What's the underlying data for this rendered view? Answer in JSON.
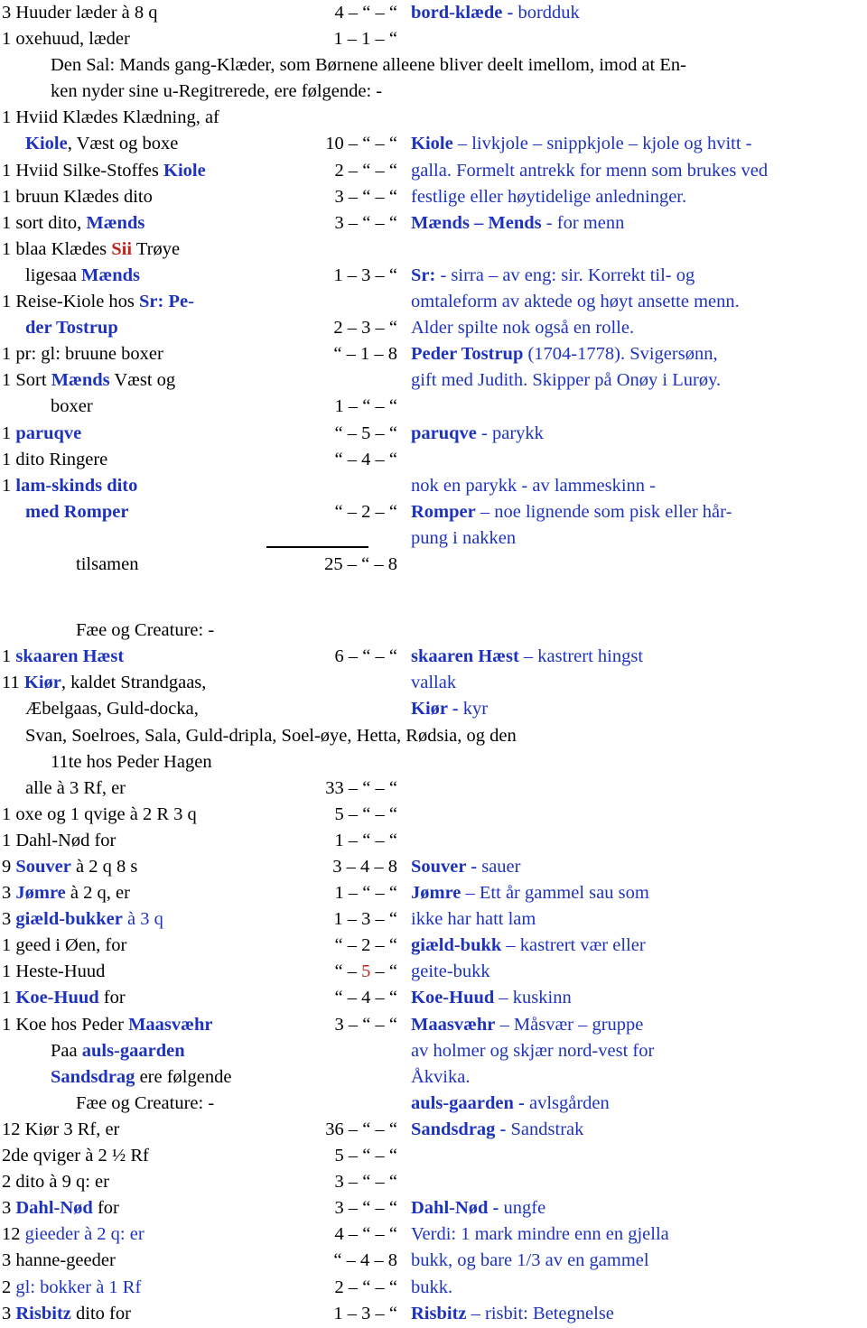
{
  "document": {
    "type": "historical-probate-inventory-transcription",
    "colors": {
      "body_text": "#000000",
      "annotation_blue": "#1d33bd",
      "highlight_red": "#c0261a",
      "background": "#ffffff"
    }
  },
  "rows": [
    {
      "item_plain": "3 Huuder læder à 8 q",
      "amount": "4 – “ – “",
      "note": "bord-klæde - bordduk",
      "note_bold_prefix": "bord-klæde -",
      "note_rest": " bordduk"
    },
    {
      "item_plain": "1 oxehuud, læder",
      "amount": "1 – 1 – “",
      "note": ""
    },
    {
      "item_plain": "Den Sal: Mands gang-Klæder, som Børnene alleene bliver deelt imellom, imod at En-",
      "amount": "",
      "note": ""
    },
    {
      "item_plain": "ken nyder sine u-Regitrerede, ere følgende: -",
      "amount": "",
      "note": ""
    },
    {
      "item_plain": "1 Hviid Klædes Klædning, af",
      "amount": "",
      "note": ""
    },
    {
      "item_plain": "Kiole, Væst og boxe",
      "amount": "10 – “ – “",
      "note": "Kiole – livkjole – snippkjole – kjole og hvitt -"
    },
    {
      "item_plain": "1 Hviid Silke-Stoffes Kiole",
      "amount": "2 – “ – “",
      "note": "galla. Formelt antrekk for menn som brukes ved"
    },
    {
      "item_plain": "1 bruun Klædes dito",
      "amount": "3 – “ – “",
      "note": "festlige eller høytidelige anledninger."
    },
    {
      "item_plain": "1 sort dito, Mænds",
      "amount": "3 – “ – “",
      "note": "Mænds – Mends  - for menn"
    },
    {
      "item_plain": "1 blaa Klædes Sii Trøye",
      "amount": "",
      "note": ""
    },
    {
      "item_plain": "ligesaa Mænds",
      "amount": "1 – 3 – “",
      "note": "Sr: - sirra – av eng: sir. Korrekt til- og"
    },
    {
      "item_plain": "1 Reise-Kiole hos Sr: Pe-",
      "amount": "",
      "note": "omtaleform av aktede og høyt ansette menn."
    },
    {
      "item_plain": "der Tostrup",
      "amount": "2 – 3 – “",
      "note": "Alder spilte nok også en rolle."
    },
    {
      "item_plain": "1 pr: gl: bruune boxer",
      "amount": "“ – 1 – 8",
      "note": "Peder Tostrup (1704-1778). Svigersønn,"
    },
    {
      "item_plain": "1 Sort Mænds Væst og",
      "amount": "",
      "note": "gift med Judith. Skipper på Onøy i Lurøy."
    },
    {
      "item_plain": "boxer",
      "amount": "1 – “ – “",
      "note": ""
    },
    {
      "item_plain": "1 paruqve",
      "amount": "“ – 5 – “",
      "note": "paruqve - parykk"
    },
    {
      "item_plain": "1 dito Ringere",
      "amount": "“ – 4 – “",
      "note": ""
    },
    {
      "item_plain": "1 lam-skinds dito",
      "amount": "",
      "note": "nok en parykk - av lammeskinn -"
    },
    {
      "item_plain": "med Romper",
      "amount": "“ – 2 – “",
      "note": "Romper – noe lignende som pisk eller hår-"
    },
    {
      "item_plain": "",
      "amount": "",
      "note": "pung i nakken"
    },
    {
      "item_plain": "tilsamen",
      "amount": "25 – “ – 8",
      "note": ""
    },
    {
      "item_plain": "Fæe og Creature: -",
      "amount": "",
      "note": ""
    },
    {
      "item_plain": "1 skaaren Hæst",
      "amount": "6 – “ – “",
      "note": "skaaren Hæst – kastrert hingst"
    },
    {
      "item_plain": "11 Kiør, kaldet Strandgaas,",
      "amount": "",
      "note": "vallak"
    },
    {
      "item_plain": "Æbelgaas, Guld-docka,",
      "amount": "",
      "note": "Kiør - kyr"
    },
    {
      "item_plain": "Svan, Soelroes, Sala, Guld-dripla, Soel-øye, Hetta, Rødsia, og den",
      "amount": "",
      "note": ""
    },
    {
      "item_plain": "11te hos Peder Hagen",
      "amount": "",
      "note": ""
    },
    {
      "item_plain": "alle à 3 Rf, er",
      "amount": "33 – “ – “",
      "note": ""
    },
    {
      "item_plain": "1 oxe og 1 qvige à 2 R 3 q",
      "amount": "5 – “ – “",
      "note": ""
    },
    {
      "item_plain": "1 Dahl-Nød for",
      "amount": "1 – “ – “",
      "note": ""
    },
    {
      "item_plain": "9 Souver à 2 q 8 s",
      "amount": "3 – 4 – 8",
      "note": "Souver - sauer"
    },
    {
      "item_plain": "3 Jømre à 2 q, er",
      "amount": "1 – “ – “",
      "note": "Jømre – Ett år gammel sau som"
    },
    {
      "item_plain": "3 giæld-bukker à 3 q",
      "amount": "1 – 3 – “",
      "note": "ikke har hatt lam"
    },
    {
      "item_plain": "1 geed i Øen, for",
      "amount": "“ – 2 – “",
      "note": "giæld-bukk – kastrert vær eller"
    },
    {
      "item_plain": "1 Heste-Huud",
      "amount": "“ – 5 – “",
      "note": "geite-bukk"
    },
    {
      "item_plain": "1 Koe-Huud for",
      "amount": "“ – 4 – “",
      "note": "Koe-Huud – kuskinn"
    },
    {
      "item_plain": "1 Koe hos Peder Maasvæhr",
      "amount": "3 – “ – “",
      "note": "Maasvæhr – Måsvær – gruppe"
    },
    {
      "item_plain": "Paa auls-gaarden",
      "amount": "",
      "note": "av holmer og skjær nord-vest for"
    },
    {
      "item_plain": "Sandsdrag ere følgende",
      "amount": "",
      "note": "Åkvika."
    },
    {
      "item_plain": "Fæe og Creature: -",
      "amount": "",
      "note": "auls-gaarden - avlsgården"
    },
    {
      "item_plain": "12 Kiør 3 Rf, er",
      "amount": "36 – “ – “",
      "note": "Sandsdrag - Sandstrak"
    },
    {
      "item_plain": "2de qviger à 2 ½ Rf",
      "amount": "5 – “ – “",
      "note": ""
    },
    {
      "item_plain": "2 dito à 9 q: er",
      "amount": "3 – “ – “",
      "note": ""
    },
    {
      "item_plain": "3 Dahl-Nød for",
      "amount": "3 – “ – “",
      "note": "Dahl-Nød - ungfe"
    },
    {
      "item_plain": "12 gieeder à 2 q: er",
      "amount": "4 – “ – “",
      "note": "Verdi: 1 mark mindre enn en gjella"
    },
    {
      "item_plain": "3 hanne-geeder",
      "amount": "“ – 4 – 8",
      "note": "bukk, og bare 1/3 av en gammel"
    },
    {
      "item_plain": "2 gl: bokker à 1 Rf",
      "amount": "2 – “ – “",
      "note": "bukk."
    },
    {
      "item_plain": "3 Risbitz dito for",
      "amount": "1 – 3 – “",
      "note": "Risbitz – risbit: Betegnelse"
    }
  ],
  "labels": {
    "tilsamen": "tilsamen",
    "fae_og_creature": "Fæe og Creature: -"
  }
}
